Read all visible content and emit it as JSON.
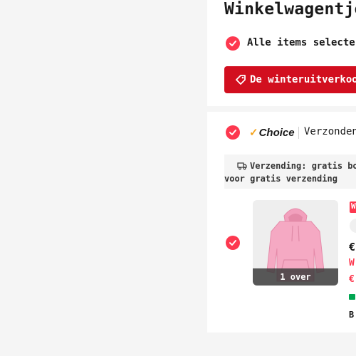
{
  "cart": {
    "title": "Winkelwagentje",
    "select_all_label": "Alle items selecteren",
    "sale_banner": "De winteruitverkoop"
  },
  "shipping_group": {
    "choice_logo_text": "Choice",
    "vendor_label": "Verzonden",
    "shipping_line1": "Verzending: gratis bo",
    "shipping_line2": "voor gratis verzending"
  },
  "product": {
    "stock_text": "1 over",
    "side_badge": "W",
    "side_price": "€",
    "side_red1": "W",
    "side_red2": "€",
    "side_bottom": "B",
    "image_color": "#f4a7c0"
  },
  "colors": {
    "accent": "#fd384f",
    "banner": "#d20f1f",
    "choice_check": "#f5a623",
    "green": "#00a651"
  }
}
